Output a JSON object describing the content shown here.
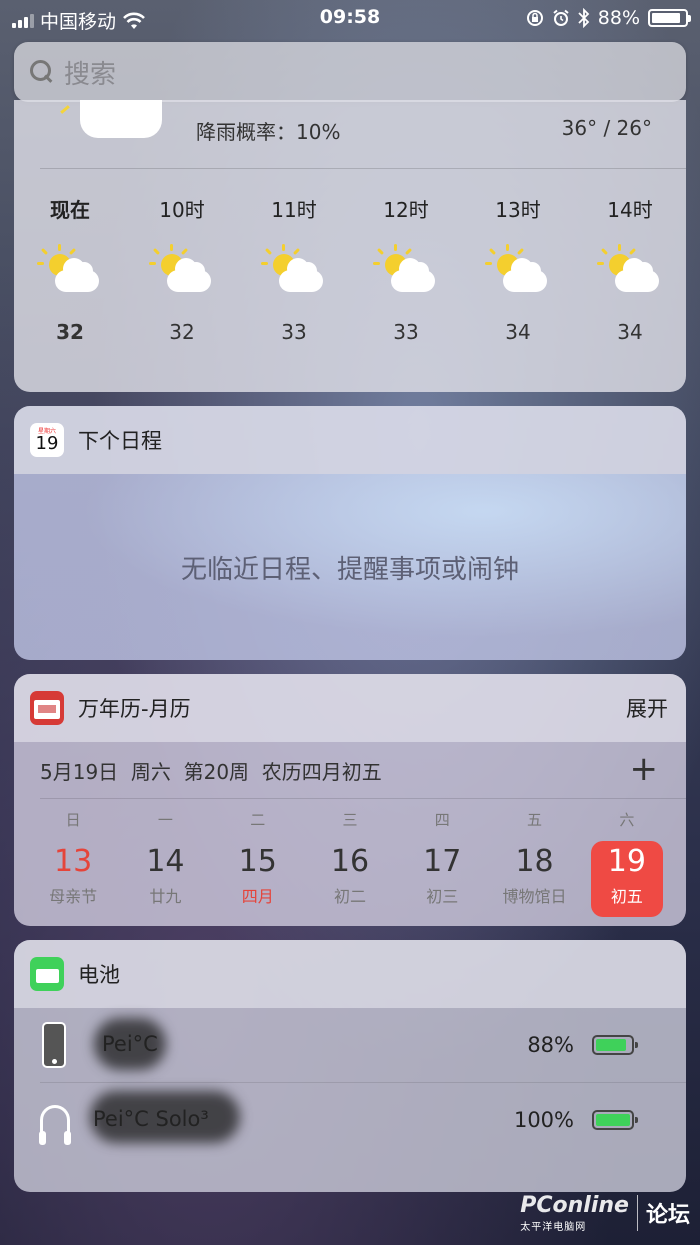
{
  "status_bar": {
    "carrier": "中国移动",
    "time": "09:58",
    "battery_pct": "88%"
  },
  "search": {
    "placeholder": "搜索"
  },
  "weather": {
    "rain_prob": "降雨概率：10%",
    "temp_range": "36° / 26°",
    "hours": [
      {
        "label": "现在",
        "temp": "32"
      },
      {
        "label": "10时",
        "temp": "32"
      },
      {
        "label": "11时",
        "temp": "33"
      },
      {
        "label": "12时",
        "temp": "33"
      },
      {
        "label": "13时",
        "temp": "34"
      },
      {
        "label": "14时",
        "temp": "34"
      }
    ],
    "icon": "partly-sunny-icon"
  },
  "schedule": {
    "icon_day": "19",
    "icon_weekday": "星期六",
    "title": "下个日程",
    "empty_text": "无临近日程、提醒事项或闹钟"
  },
  "wannianli": {
    "title": "万年历-月历",
    "expand": "展开",
    "date_line": "5月19日  周六  第20周  农历四月初五",
    "plus": "+",
    "weekdays": [
      "日",
      "一",
      "二",
      "三",
      "四",
      "五",
      "六"
    ],
    "days": [
      {
        "num": "13",
        "sub": "母亲节"
      },
      {
        "num": "14",
        "sub": "廿九"
      },
      {
        "num": "15",
        "sub": "四月"
      },
      {
        "num": "16",
        "sub": "初二"
      },
      {
        "num": "17",
        "sub": "初三"
      },
      {
        "num": "18",
        "sub": "博物馆日"
      },
      {
        "num": "19",
        "sub": "初五"
      }
    ],
    "accent_color": "#ef4a44"
  },
  "battery": {
    "title": "电池",
    "devices": [
      {
        "name": "Pei°C",
        "pct": "88%",
        "level": 0.88,
        "icon": "iphone-icon"
      },
      {
        "name": "Pei°C Solo³",
        "pct": "100%",
        "level": 1.0,
        "icon": "headphones-icon"
      }
    ],
    "fill_color": "#3fd15a"
  },
  "watermark": {
    "logo": "PConline",
    "sub": "太平洋电脑网",
    "forum": "论坛"
  }
}
